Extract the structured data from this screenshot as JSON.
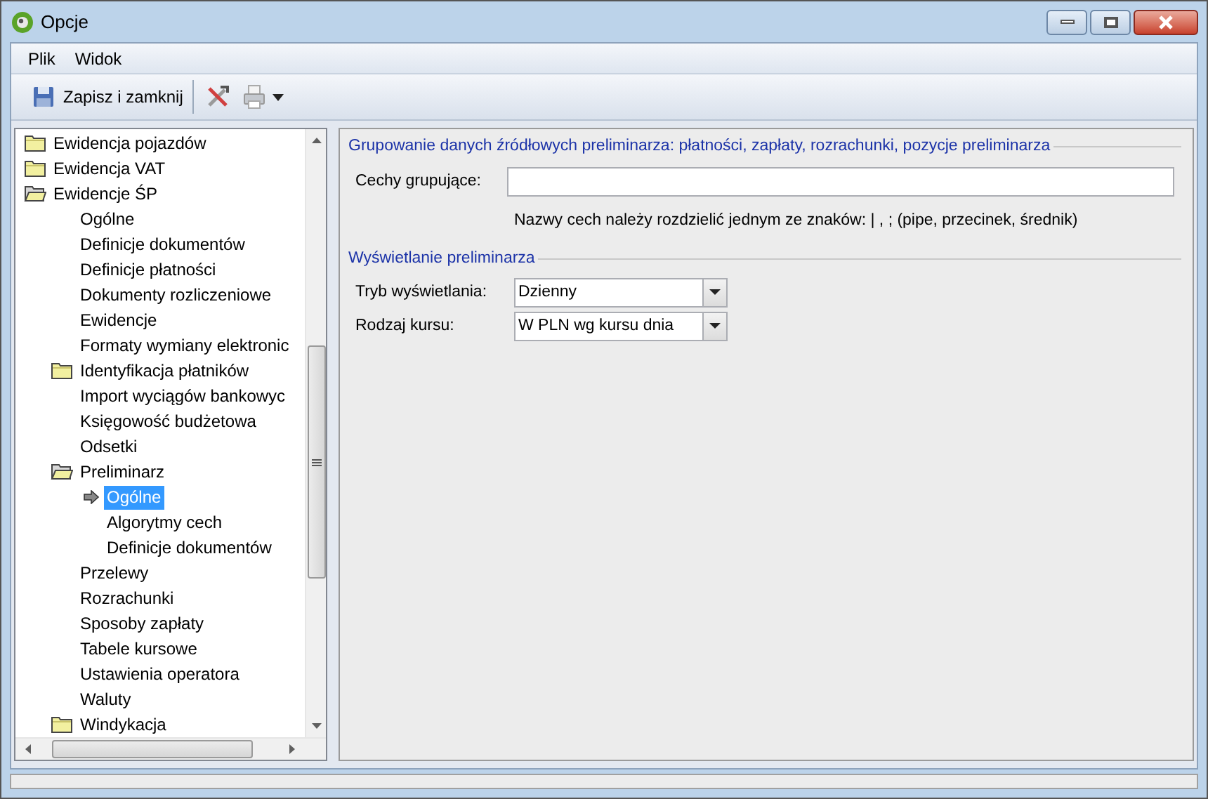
{
  "window": {
    "title": "Opcje"
  },
  "menu": [
    {
      "label": "Plik"
    },
    {
      "label": "Widok"
    }
  ],
  "toolbar": {
    "save_label": "Zapisz i zamknij"
  },
  "tree": [
    {
      "label": "Ewidencja pojazdów",
      "kind": "folder",
      "expanded": false
    },
    {
      "label": "Ewidencja VAT",
      "kind": "folder",
      "expanded": false
    },
    {
      "label": "Ewidencje ŚP",
      "kind": "folder",
      "expanded": true,
      "children": [
        {
          "label": "Ogólne",
          "kind": "leaf",
          "selected": false
        },
        {
          "label": "Definicje dokumentów",
          "kind": "leaf",
          "selected": false
        },
        {
          "label": "Definicje płatności",
          "kind": "leaf",
          "selected": false
        },
        {
          "label": "Dokumenty rozliczeniowe",
          "kind": "leaf",
          "selected": false
        },
        {
          "label": "Ewidencje",
          "kind": "leaf",
          "selected": false
        },
        {
          "label": "Formaty wymiany elektronic",
          "kind": "leaf",
          "selected": false
        },
        {
          "label": "Identyfikacja płatników",
          "kind": "folder",
          "expanded": false
        },
        {
          "label": "Import wyciągów bankowyc",
          "kind": "leaf",
          "selected": false
        },
        {
          "label": "Księgowość budżetowa",
          "kind": "leaf",
          "selected": false
        },
        {
          "label": "Odsetki",
          "kind": "leaf",
          "selected": false
        },
        {
          "label": "Preliminarz",
          "kind": "folder",
          "expanded": true,
          "children": [
            {
              "label": "Ogólne",
              "kind": "leaf",
              "selected": true
            },
            {
              "label": "Algorytmy cech",
              "kind": "leaf",
              "selected": false
            },
            {
              "label": "Definicje dokumentów",
              "kind": "leaf",
              "selected": false
            }
          ]
        },
        {
          "label": "Przelewy",
          "kind": "leaf",
          "selected": false
        },
        {
          "label": "Rozrachunki",
          "kind": "leaf",
          "selected": false
        },
        {
          "label": "Sposoby zapłaty",
          "kind": "leaf",
          "selected": false
        },
        {
          "label": "Tabele kursowe",
          "kind": "leaf",
          "selected": false
        },
        {
          "label": "Ustawienia operatora",
          "kind": "leaf",
          "selected": false
        },
        {
          "label": "Waluty",
          "kind": "leaf",
          "selected": false
        },
        {
          "label": "Windykacja",
          "kind": "folder",
          "expanded": false
        }
      ]
    }
  ],
  "group1": {
    "title": "Grupowanie danych źródłowych preliminarza: płatności, zapłaty, rozrachunki, pozycje preliminarza",
    "field_label": "Cechy grupujące:",
    "hint": "Nazwy cech należy rozdzielić jednym ze znaków: | , ; (pipe, przecinek, średnik)"
  },
  "group2": {
    "title": "Wyświetlanie preliminarza",
    "fields": [
      {
        "label": "Tryb wyświetlania:",
        "value": "Dzienny"
      },
      {
        "label": "Rodzaj kursu:",
        "value": "W PLN wg kursu dnia"
      }
    ]
  }
}
